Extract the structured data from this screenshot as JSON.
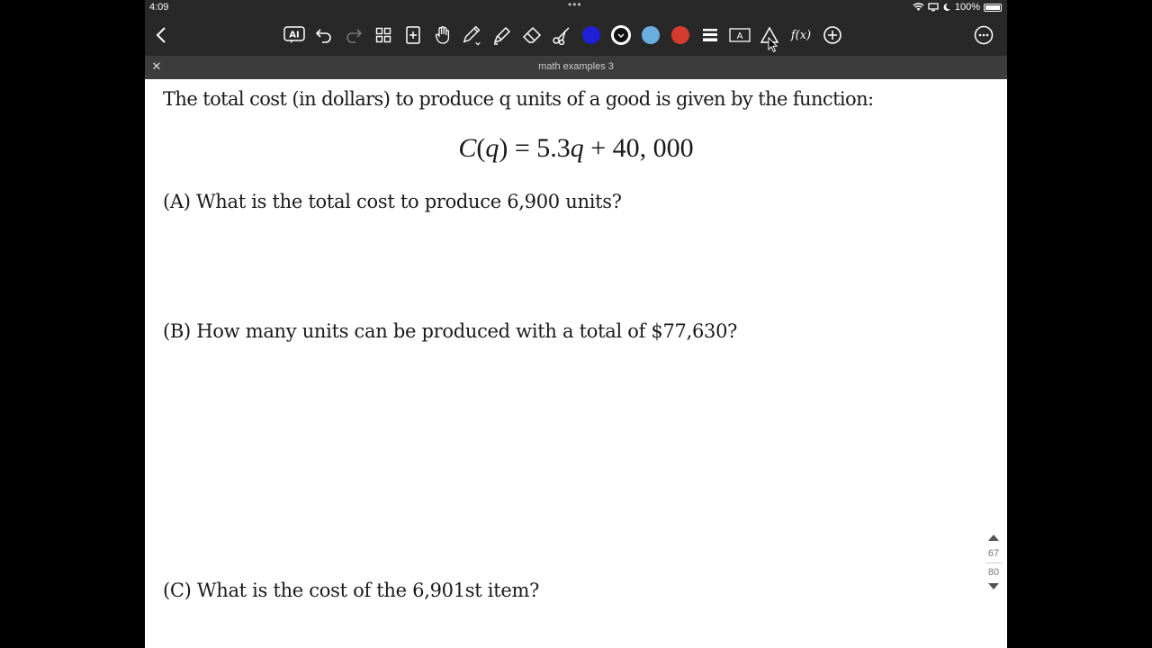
{
  "status": {
    "time": "4:09",
    "battery": "100%"
  },
  "tab": {
    "title": "math examples 3"
  },
  "toolbar": {
    "colors": [
      "#1f1fd6",
      "#111111",
      "#6aaee0",
      "#d63b2f"
    ],
    "function_label": "f(x)"
  },
  "document": {
    "intro": "The total cost (in dollars) to produce q units of a good is given by the function:",
    "formula": {
      "lhs_func": "C",
      "lhs_var": "q",
      "rhs_a": "= 5.3",
      "rhs_var": "q",
      "rhs_b": "+ 40, 000"
    },
    "question_a": "(A) What is the total cost to produce 6,900 units?",
    "question_b": "(B) How many units can be produced with a total of $77,630?",
    "question_c": "(C) What is the cost of the 6,901st item?"
  },
  "pager": {
    "current": "67",
    "total": "80"
  }
}
